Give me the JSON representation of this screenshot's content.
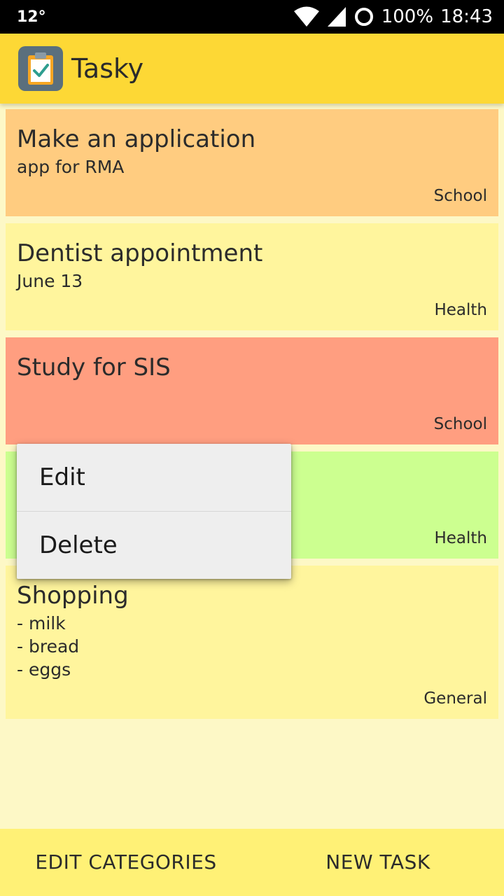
{
  "status_bar": {
    "temperature": "12°",
    "battery": "100%",
    "time": "18:43",
    "icons": [
      "wifi-icon",
      "signal-icon",
      "sync-icon"
    ]
  },
  "app_bar": {
    "title": "Tasky",
    "logo_icon": "clipboard-check-icon"
  },
  "tasks": [
    {
      "title": "Make an application",
      "description": "app for RMA",
      "category": "School",
      "color": "#FFCC80"
    },
    {
      "title": "Dentist appointment",
      "description": "June 13",
      "category": "Health",
      "color": "#FFF59D"
    },
    {
      "title": "Study for SIS",
      "description": "",
      "category": "School",
      "color": "#FF9E80"
    },
    {
      "title": "",
      "description": "",
      "category": "Health",
      "color": "#CCFF90"
    },
    {
      "title": "Shopping",
      "description": "- milk\n- bread\n- eggs",
      "category": "General",
      "color": "#FFF59D"
    }
  ],
  "context_menu": {
    "edit_label": "Edit",
    "delete_label": "Delete"
  },
  "bottom_bar": {
    "edit_categories_label": "EDIT CATEGORIES",
    "new_task_label": "NEW TASK"
  },
  "colors": {
    "app_bar": "#FDD835",
    "bottom_bar": "#FFF176",
    "background": "#FDF8C6",
    "logo_bg": "#5A6F7D"
  }
}
